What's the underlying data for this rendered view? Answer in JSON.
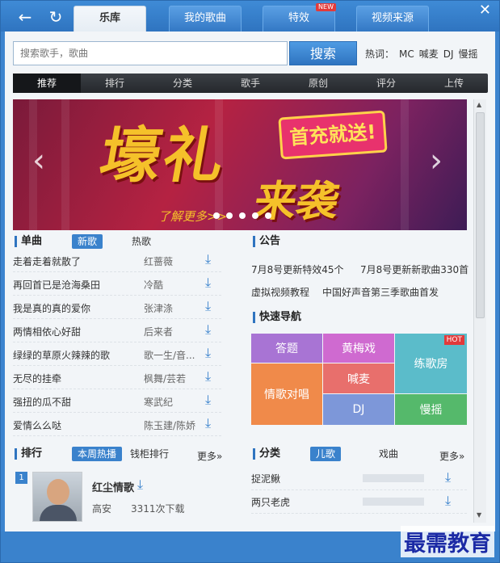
{
  "tabs": [
    {
      "label": "乐库"
    },
    {
      "label": "我的歌曲"
    },
    {
      "label": "特效",
      "badge": "NEW"
    },
    {
      "label": "视频来源"
    }
  ],
  "search": {
    "placeholder": "搜索歌手，歌曲",
    "button": "搜索"
  },
  "hotwords": {
    "label": "热词：",
    "items": [
      "MC",
      "喊麦",
      "DJ",
      "慢摇"
    ]
  },
  "categories": [
    "推荐",
    "排行",
    "分类",
    "歌手",
    "原创",
    "评分",
    "上传"
  ],
  "banner": {
    "line1": "壕礼",
    "line2": "来袭",
    "sticker": "首充就送!",
    "more": "了解更多>>"
  },
  "singles": {
    "title": "单曲",
    "tabs": [
      "新歌",
      "热歌"
    ],
    "rows": [
      {
        "title": "走着走着就散了",
        "artist": "红蔷薇"
      },
      {
        "title": "再回首已是沧海桑田",
        "artist": "冷酷"
      },
      {
        "title": "我是真的真的爱你",
        "artist": "张津涤"
      },
      {
        "title": "两情相依心好甜",
        "artist": "后来者"
      },
      {
        "title": "绿绿的草原火辣辣的歌",
        "artist": "歌一生/音..."
      },
      {
        "title": "无尽的挂牵",
        "artist": "枫舞/芸若"
      },
      {
        "title": "强扭的瓜不甜",
        "artist": "寒武纪"
      },
      {
        "title": "爱情么么哒",
        "artist": "陈玉建/陈娇"
      }
    ]
  },
  "notice": {
    "title": "公告",
    "items": [
      "7月8号更新特效45个",
      "7月8号更新新歌曲330首",
      "虚拟视频教程",
      "中国好声音第三季歌曲首发"
    ]
  },
  "quicknav": {
    "title": "快速导航",
    "cells": [
      "答题",
      "黄梅戏",
      "练歌房",
      "情歌对唱",
      "喊麦",
      "DJ",
      "慢摇"
    ],
    "hot_badge": "HOT",
    "colors": [
      "#a874d4",
      "#cf6ad0",
      "#5bbcca",
      "#f08a4a",
      "#e86f6c",
      "#7d97d9",
      "#55b96b"
    ]
  },
  "ranking": {
    "title": "排行",
    "tabs": [
      "本周热播",
      "钱柜排行"
    ],
    "more": "更多»",
    "top": {
      "rank": "1",
      "title": "红尘情歌",
      "artist": "高安",
      "plays": "3311次下载"
    }
  },
  "classify": {
    "title": "分类",
    "tabs": [
      "儿歌",
      "戏曲"
    ],
    "more": "更多»",
    "rows": [
      "捉泥鳅",
      "两只老虎"
    ]
  },
  "watermark": "最需教育"
}
